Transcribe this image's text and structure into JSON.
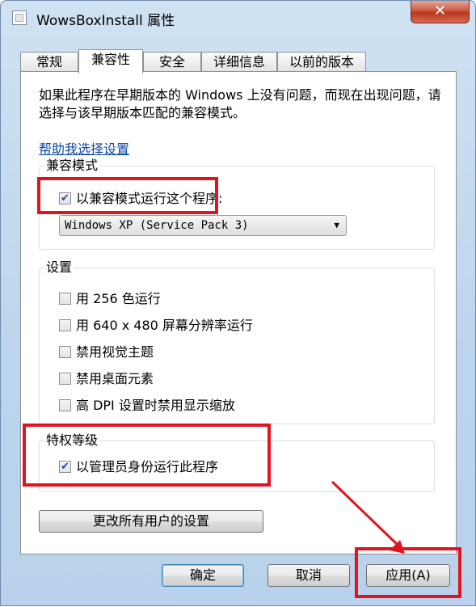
{
  "window": {
    "title": "WowsBoxInstall 属性",
    "close_label": "✕"
  },
  "tabs": [
    {
      "label": "常规"
    },
    {
      "label": "兼容性"
    },
    {
      "label": "安全"
    },
    {
      "label": "详细信息"
    },
    {
      "label": "以前的版本"
    }
  ],
  "intro": "如果此程序在早期版本的 Windows 上没有问题，而现在出现问题，请选择与该早期版本匹配的兼容模式。",
  "help_link": "帮助我选择设置",
  "compat": {
    "group_label": "兼容模式",
    "checkbox_label": "以兼容模式运行这个程序:",
    "checked": true,
    "selected_os": "Windows XP (Service Pack 3)"
  },
  "settings": {
    "group_label": "设置",
    "items": [
      {
        "label": "用 256 色运行",
        "checked": false
      },
      {
        "label": "用 640 x 480 屏幕分辨率运行",
        "checked": false
      },
      {
        "label": "禁用视觉主题",
        "checked": false
      },
      {
        "label": "禁用桌面元素",
        "checked": false
      },
      {
        "label": "高 DPI 设置时禁用显示缩放",
        "checked": false
      }
    ]
  },
  "privilege": {
    "group_label": "特权等级",
    "checkbox_label": "以管理员身份运行此程序",
    "checked": true
  },
  "change_all_users_button": "更改所有用户的设置",
  "footer": {
    "ok": "确定",
    "cancel": "取消",
    "apply": "应用(A)"
  },
  "annotation_color": "#e0141e"
}
